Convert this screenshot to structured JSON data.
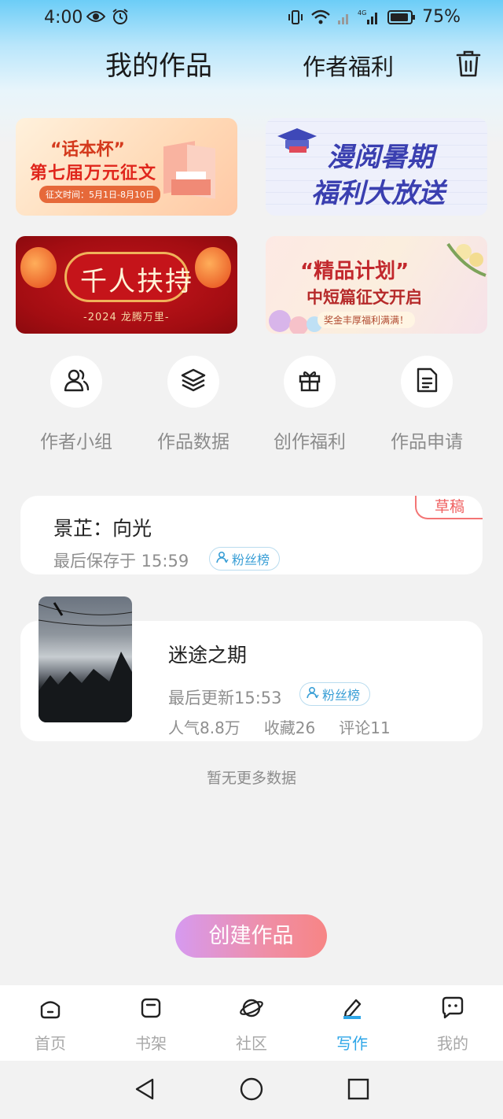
{
  "status_bar": {
    "time": "4:00",
    "battery": "75%",
    "network": "4G"
  },
  "header": {
    "title": "我的作品",
    "benefit_link": "作者福利"
  },
  "banners": [
    {
      "line1": "“话本杯”",
      "line2": "第七届万元征文",
      "line3": "征文时间：5月1日-8月10日"
    },
    {
      "line1": "漫阅暑期",
      "line2": "福利大放送"
    },
    {
      "line1": "千人扶持",
      "line2": "-2024 龙腾万里-"
    },
    {
      "line1": "“精品计划”",
      "line2": "中短篇征文开启",
      "line3": "奖金丰厚福利满满！"
    }
  ],
  "shortcuts": [
    {
      "label": "作者小组",
      "icon": "group-icon"
    },
    {
      "label": "作品数据",
      "icon": "layers-icon"
    },
    {
      "label": "创作福利",
      "icon": "gift-icon"
    },
    {
      "label": "作品申请",
      "icon": "document-icon"
    }
  ],
  "works": [
    {
      "title": "景芷：向光",
      "meta": "最后保存于 15:59",
      "badge": "草稿",
      "tag": "粉丝榜"
    },
    {
      "title": "迷途之期",
      "meta": "最后更新15:53",
      "tag": "粉丝榜",
      "popularity": "人气8.8万",
      "favorites": "收藏26",
      "comments": "评论11"
    }
  ],
  "no_more": "暂无更多数据",
  "create_button": "创建作品",
  "tabbar": [
    {
      "label": "首页",
      "icon": "home-icon",
      "active": false
    },
    {
      "label": "书架",
      "icon": "bookshelf-icon",
      "active": false
    },
    {
      "label": "社区",
      "icon": "planet-icon",
      "active": false
    },
    {
      "label": "写作",
      "icon": "pen-icon",
      "active": true
    },
    {
      "label": "我的",
      "icon": "chat-bubble-icon",
      "active": false
    }
  ],
  "colors": {
    "accent": "#2ea6e8",
    "draft": "#ef6060",
    "tag": "#3a9fd6"
  }
}
